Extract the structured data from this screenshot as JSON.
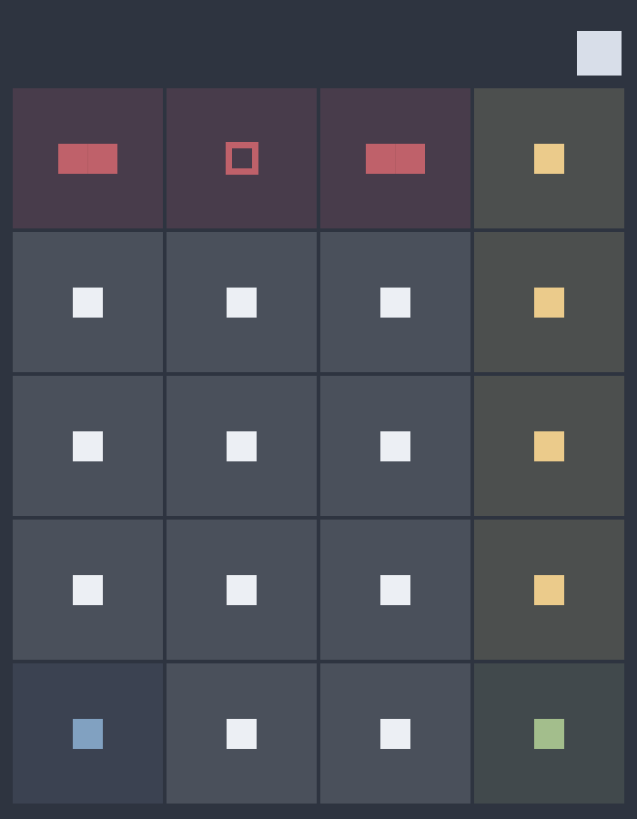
{
  "app": {
    "background": "#2e3440",
    "top_action": {
      "icon": "square-icon",
      "color": "#d8dee9"
    }
  },
  "keypad": {
    "rows": [
      [
        {
          "name": "function-key-1",
          "icon": "wide-bar-icon",
          "kind": "fn",
          "color": "#bf616a"
        },
        {
          "name": "function-key-2",
          "icon": "outlined-square-icon",
          "kind": "fn",
          "color": "#bf616a"
        },
        {
          "name": "function-key-3",
          "icon": "wide-bar-icon",
          "kind": "fn",
          "color": "#bf616a"
        },
        {
          "name": "operator-key-1",
          "icon": "square-icon",
          "kind": "op",
          "color": "#ebcb8b"
        }
      ],
      [
        {
          "name": "number-key-1",
          "icon": "square-icon",
          "kind": "num",
          "color": "#eceff4"
        },
        {
          "name": "number-key-2",
          "icon": "square-icon",
          "kind": "num",
          "color": "#eceff4"
        },
        {
          "name": "number-key-3",
          "icon": "square-icon",
          "kind": "num",
          "color": "#eceff4"
        },
        {
          "name": "operator-key-2",
          "icon": "square-icon",
          "kind": "op",
          "color": "#ebcb8b"
        }
      ],
      [
        {
          "name": "number-key-4",
          "icon": "square-icon",
          "kind": "num",
          "color": "#eceff4"
        },
        {
          "name": "number-key-5",
          "icon": "square-icon",
          "kind": "num",
          "color": "#eceff4"
        },
        {
          "name": "number-key-6",
          "icon": "square-icon",
          "kind": "num",
          "color": "#eceff4"
        },
        {
          "name": "operator-key-3",
          "icon": "square-icon",
          "kind": "op",
          "color": "#ebcb8b"
        }
      ],
      [
        {
          "name": "number-key-7",
          "icon": "square-icon",
          "kind": "num",
          "color": "#eceff4"
        },
        {
          "name": "number-key-8",
          "icon": "square-icon",
          "kind": "num",
          "color": "#eceff4"
        },
        {
          "name": "number-key-9",
          "icon": "square-icon",
          "kind": "num",
          "color": "#eceff4"
        },
        {
          "name": "operator-key-4",
          "icon": "square-icon",
          "kind": "op",
          "color": "#ebcb8b"
        }
      ],
      [
        {
          "name": "special-key-1",
          "icon": "square-icon",
          "kind": "mem",
          "color": "#81a1c1"
        },
        {
          "name": "number-key-0",
          "icon": "square-icon",
          "kind": "num",
          "color": "#eceff4"
        },
        {
          "name": "number-key-10",
          "icon": "square-icon",
          "kind": "num",
          "color": "#eceff4"
        },
        {
          "name": "equals-key",
          "icon": "square-icon",
          "kind": "eq",
          "color": "#a3be8c"
        }
      ]
    ]
  }
}
